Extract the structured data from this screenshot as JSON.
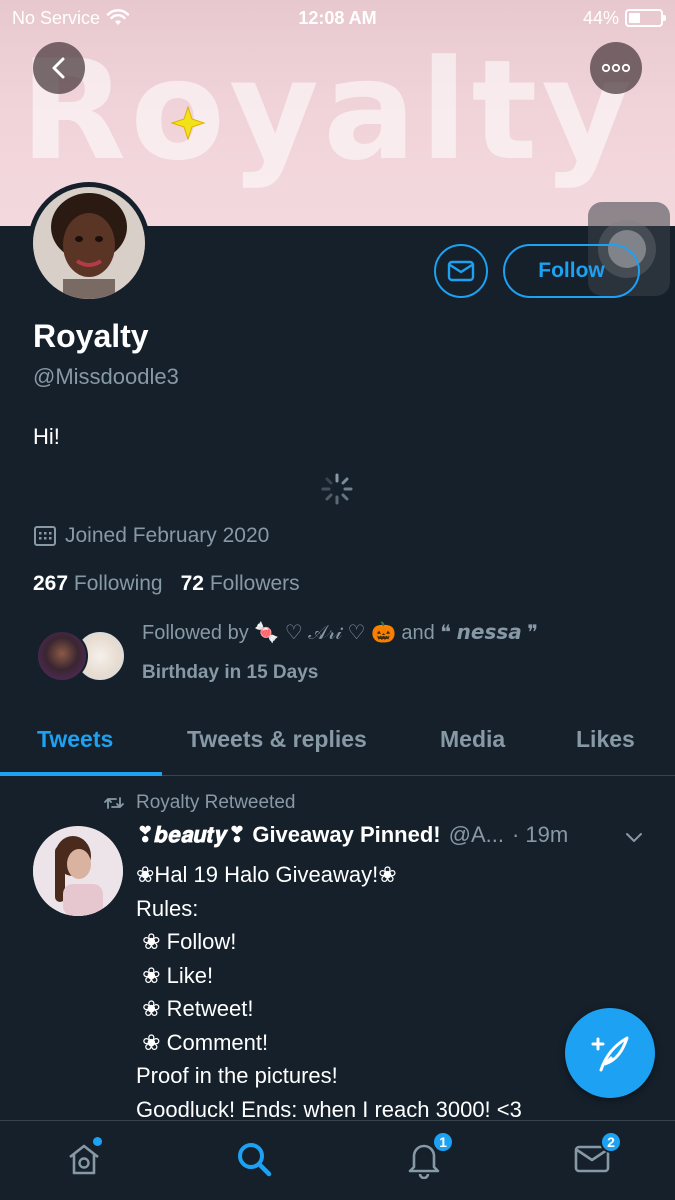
{
  "status_bar": {
    "carrier": "No Service",
    "time": "12:08 AM",
    "battery": "44%",
    "battery_level": 0.44
  },
  "banner": {
    "text": "Royalty"
  },
  "profile": {
    "name": "Royalty",
    "handle": "@Missdoodle3",
    "bio": "Hi!",
    "joined": "Joined February 2020",
    "following_count": "267",
    "following_label": "Following",
    "followers_count": "72",
    "followers_label": "Followers",
    "followed_by": "Followed by 🍬 ♡ 𝒜𝓇𝒾 ♡ 🎃 and ❝ 𝙣𝙚𝙨𝙨𝙖 ❞",
    "birthday": "Birthday in 15 Days",
    "follow_label": "Follow"
  },
  "tabs": [
    {
      "label": "Tweets",
      "active": true
    },
    {
      "label": "Tweets & replies",
      "active": false
    },
    {
      "label": "Media",
      "active": false
    },
    {
      "label": "Likes",
      "active": false
    }
  ],
  "tweet": {
    "retweet_label": "Royalty Retweeted",
    "author": "❣𝒃𝒆𝒂𝒖𝒕𝒚❣ Giveaway Pinned!",
    "handle": "@A...",
    "time": "· 19m",
    "body": "❀Hal 19 Halo Giveaway!❀\nRules:\n ❀ Follow!\n ❀ Like!\n ❀ Retweet!\n ❀ Comment!\nProof in the pictures!\nGoodluck! Ends: when I reach 3000! <3"
  },
  "bottom_nav": {
    "notifications_badge": "1",
    "messages_badge": "2"
  },
  "colors": {
    "background": "#15202b",
    "accent": "#1da1f2",
    "secondary_text": "#8899a6"
  }
}
